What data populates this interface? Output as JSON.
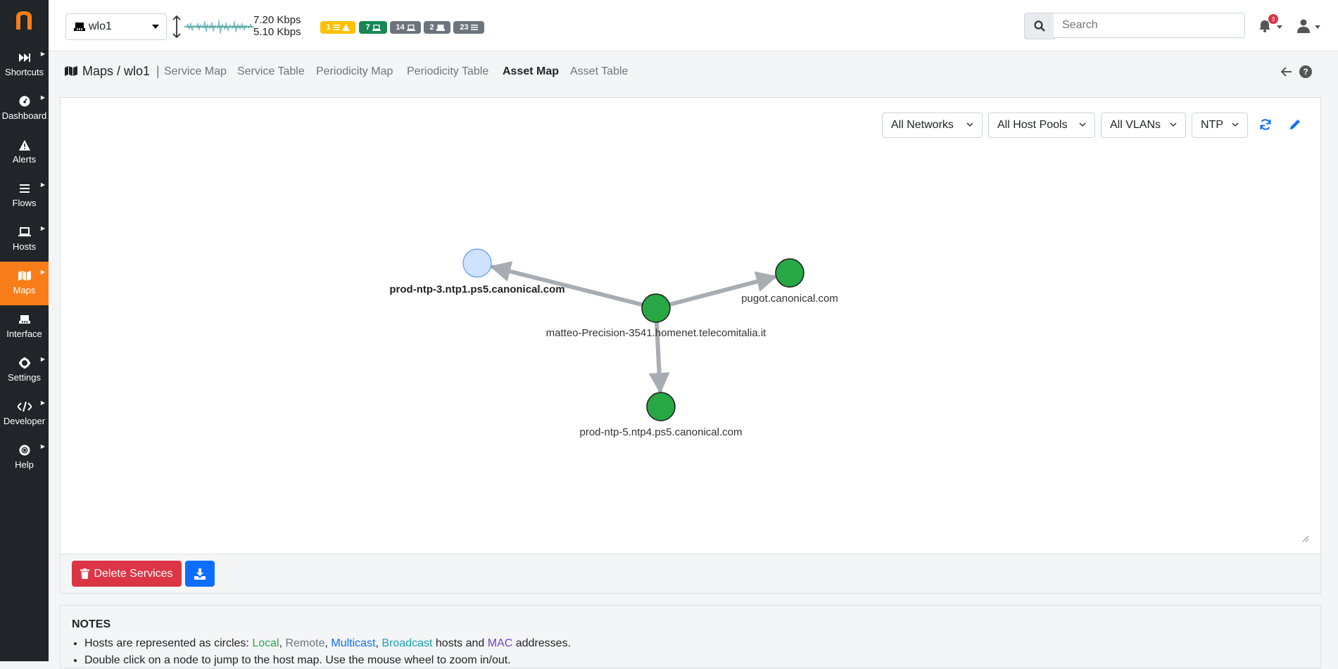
{
  "sidebar": {
    "items": [
      {
        "label": "Shortcuts",
        "icon": "fast-forward-icon",
        "has_submenu": true,
        "active": false
      },
      {
        "label": "Dashboard",
        "icon": "gauge-icon",
        "has_submenu": true,
        "active": false
      },
      {
        "label": "Alerts",
        "icon": "warning-icon",
        "has_submenu": false,
        "active": false
      },
      {
        "label": "Flows",
        "icon": "list-icon",
        "has_submenu": true,
        "active": false
      },
      {
        "label": "Hosts",
        "icon": "laptop-icon",
        "has_submenu": true,
        "active": false
      },
      {
        "label": "Maps",
        "icon": "map-icon",
        "has_submenu": true,
        "active": true
      },
      {
        "label": "Interface",
        "icon": "ethernet-icon",
        "has_submenu": false,
        "active": false
      },
      {
        "label": "Settings",
        "icon": "gear-icon",
        "has_submenu": true,
        "active": false
      },
      {
        "label": "Developer",
        "icon": "code-icon",
        "has_submenu": true,
        "active": false
      },
      {
        "label": "Help",
        "icon": "lifering-icon",
        "has_submenu": true,
        "active": false
      }
    ]
  },
  "topbar": {
    "interface": "wlo1",
    "upload_speed": "7.20 Kbps",
    "download_speed": "5.10 Kbps",
    "badges": [
      {
        "count": "1",
        "icon": "list-icon",
        "icon2": "warning-icon",
        "color": "#ffc107"
      },
      {
        "count": "7",
        "icon": "laptop-icon",
        "color": "#198754"
      },
      {
        "count": "14",
        "icon": "laptop-icon",
        "color": "#6c757d"
      },
      {
        "count": "2",
        "icon": "ethernet-icon",
        "color": "#6c757d"
      },
      {
        "count": "23",
        "icon": "list-icon",
        "color": "#6c757d"
      }
    ],
    "search_placeholder": "Search",
    "notifications_count": "3"
  },
  "breadcrumb": {
    "title": "Maps / wlo1",
    "separator": "|",
    "tabs": [
      {
        "label": "Service Map",
        "active": false
      },
      {
        "label": "Service Table",
        "active": false
      },
      {
        "label": "Periodicity Map",
        "active": false
      },
      {
        "label": "Periodicity Table",
        "active": false
      },
      {
        "label": "Asset Map",
        "active": true
      },
      {
        "label": "Asset Table",
        "active": false
      }
    ]
  },
  "filters": {
    "networks": "All Networks",
    "host_pools": "All Host Pools",
    "vlans": "All VLANs",
    "protocol": "NTP"
  },
  "graph": {
    "nodes": [
      {
        "id": "center",
        "label": "matteo-Precision-3541.homenet.telecomitalia.it",
        "type": "local",
        "color": "#28a745"
      },
      {
        "id": "ntp3",
        "label": "prod-ntp-3.ntp1.ps5.canonical.com",
        "type": "remote",
        "color": "#cfe2ff",
        "bold": true
      },
      {
        "id": "pugot",
        "label": "pugot.canonical.com",
        "type": "local",
        "color": "#28a745"
      },
      {
        "id": "ntp5",
        "label": "prod-ntp-5.ntp4.ps5.canonical.com",
        "type": "local",
        "color": "#28a745"
      }
    ],
    "edges": [
      {
        "from": "center",
        "to": "ntp3"
      },
      {
        "from": "center",
        "to": "pugot"
      },
      {
        "from": "center",
        "to": "ntp5"
      }
    ],
    "edge_color": "#a8adb3"
  },
  "footer": {
    "delete_label": "Delete Services"
  },
  "notes": {
    "title": "NOTES",
    "line1_prefix": "Hosts are represented as circles: ",
    "local": "Local",
    "sep1": ", ",
    "remote": "Remote",
    "sep2": ", ",
    "multicast": "Multicast",
    "sep3": ", ",
    "broadcast": "Broadcast",
    "line1_mid": " hosts and ",
    "mac": "MAC",
    "line1_suffix": " addresses.",
    "line2": "Double click on a node to jump to the host map. Use the mouse wheel to zoom in/out."
  }
}
